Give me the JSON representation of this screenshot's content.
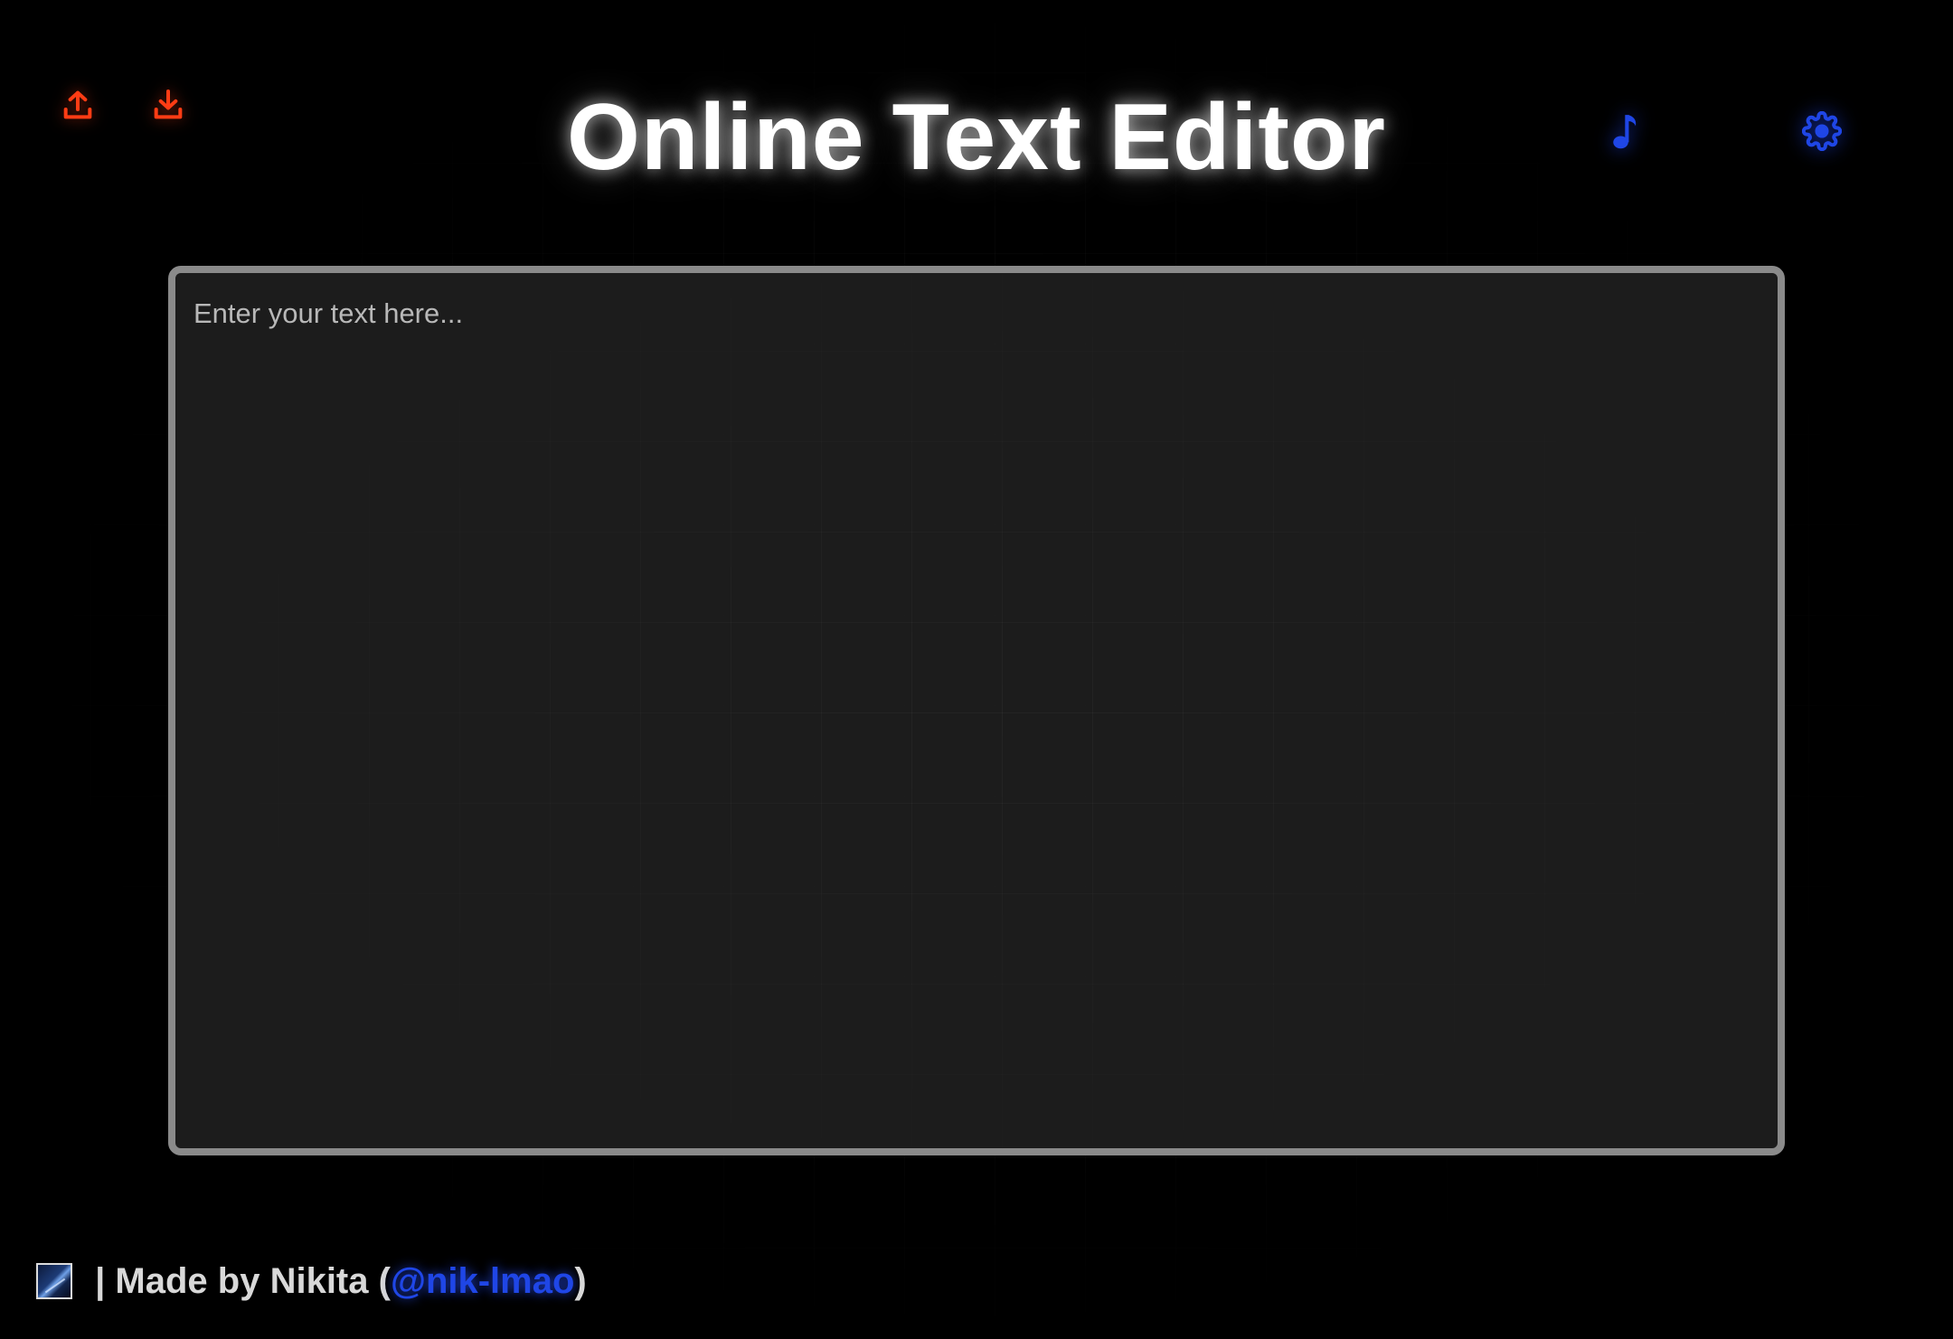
{
  "header": {
    "title": "Online Text Editor",
    "icons": {
      "upload": "upload-icon",
      "download": "download-icon",
      "music": "music-note-icon",
      "settings": "gear-icon"
    }
  },
  "editor": {
    "placeholder": "Enter your text here...",
    "value": ""
  },
  "footer": {
    "separator_text": " | Made by Nikita (",
    "link_text": "@nik-lmao",
    "close_paren": ")"
  },
  "colors": {
    "background": "#000000",
    "editor_background": "#1e1e1e",
    "editor_border": "#8a8a8a",
    "accent_red": "#ff3c14",
    "accent_blue": "#1f46e6",
    "title": "#ffffff"
  }
}
